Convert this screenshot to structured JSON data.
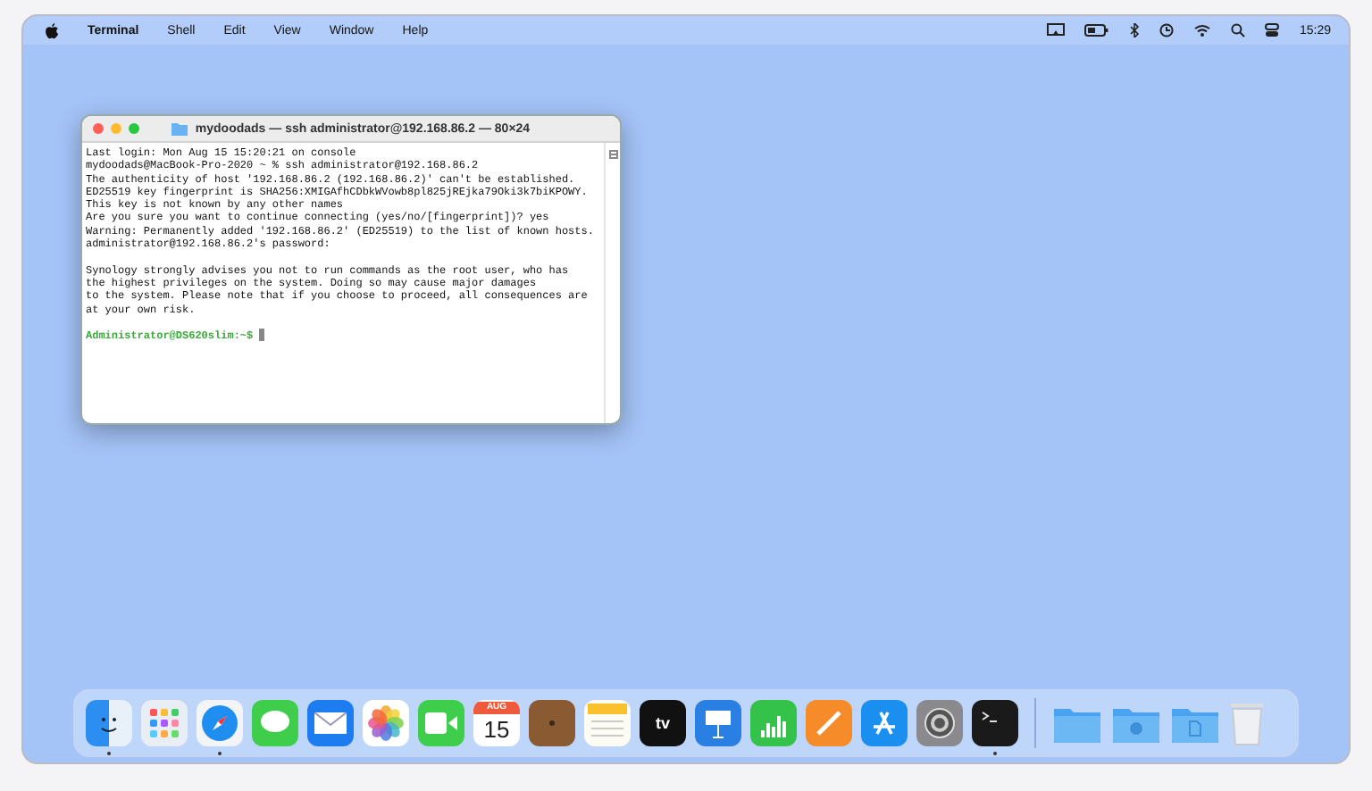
{
  "menu_bar": {
    "app": "Terminal",
    "menus": [
      "Shell",
      "Edit",
      "View",
      "Window",
      "Help"
    ],
    "status_icons": [
      {
        "kind": "mirroring"
      },
      {
        "kind": "battery"
      },
      {
        "kind": "bluetooth"
      },
      {
        "kind": "clock"
      },
      {
        "kind": "wifi"
      },
      {
        "kind": "search"
      },
      {
        "kind": "controls"
      }
    ],
    "time": "15:29"
  },
  "terminal": {
    "title": "mydoodads — ssh administrator@192.168.86.2 — 80×24",
    "output_lines": [
      "Last login: Mon Aug 15 15:20:21 on console",
      "mydoodads@MacBook-Pro-2020 ~ % ssh administrator@192.168.86.2",
      "The authenticity of host '192.168.86.2 (192.168.86.2)' can't be established.",
      "ED25519 key fingerprint is SHA256:XMIGAfhCDbkWVowb8pl825jREjka79Oki3k7biKPOWY.",
      "This key is not known by any other names",
      "Are you sure you want to continue connecting (yes/no/[fingerprint])? yes",
      "Warning: Permanently added '192.168.86.2' (ED25519) to the list of known hosts.",
      "administrator@192.168.86.2's password:"
    ],
    "notice_lines": [
      "Synology strongly advises you not to run commands as the root user, who has",
      "the highest privileges on the system. Doing so may cause major damages",
      "to the system. Please note that if you choose to proceed, all consequences are",
      "at your own risk."
    ],
    "prompt": "Administrator@DS620slim:~$"
  },
  "dock": {
    "apps": [
      {
        "kind": "finder",
        "running": true
      },
      {
        "kind": "launchpad",
        "running": false
      },
      {
        "kind": "safari",
        "running": true
      },
      {
        "kind": "messages",
        "running": false
      },
      {
        "kind": "mail",
        "running": false
      },
      {
        "kind": "photos",
        "running": false
      },
      {
        "kind": "facetime",
        "running": false
      },
      {
        "kind": "calendar",
        "running": false,
        "month": "AUG",
        "day": "15"
      },
      {
        "kind": "notefile",
        "running": false
      },
      {
        "kind": "notes",
        "running": false
      },
      {
        "kind": "tv",
        "running": false,
        "label": "tv"
      },
      {
        "kind": "keynote",
        "running": false
      },
      {
        "kind": "numbers",
        "running": false
      },
      {
        "kind": "pages",
        "running": false
      },
      {
        "kind": "appstore",
        "running": false
      },
      {
        "kind": "settings",
        "running": false
      },
      {
        "kind": "terminal",
        "running": true
      }
    ],
    "stacks": [
      {
        "kind": "folder"
      },
      {
        "kind": "downloads"
      },
      {
        "kind": "documents"
      },
      {
        "kind": "trash"
      }
    ]
  }
}
